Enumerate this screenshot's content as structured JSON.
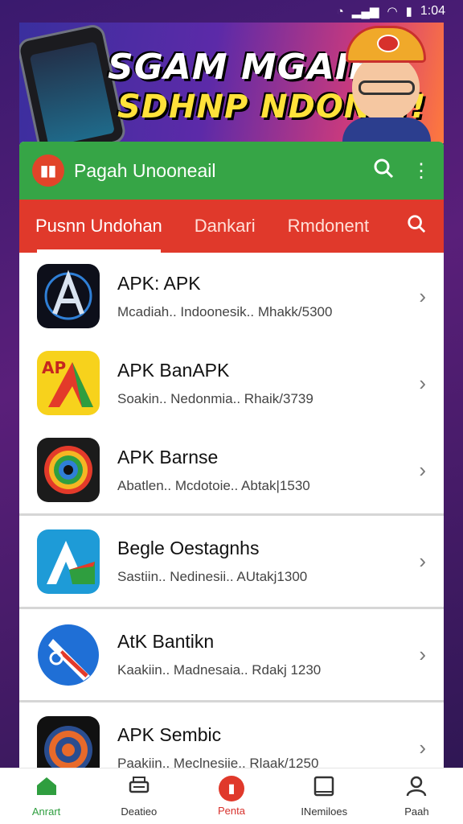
{
  "status_bar": {
    "time": "1:04",
    "icons": [
      "notification-icon",
      "signal-icon",
      "wifi-icon",
      "battery-icon"
    ]
  },
  "banner": {
    "line1": "SGAM MGAIEA",
    "line2": "SDHNP NDONS!!"
  },
  "app_bar": {
    "title": "Pagah Unooneail",
    "logo_glyph": "▮▮"
  },
  "tabs": [
    {
      "label": "Pusnn Undohan"
    },
    {
      "label": "Dankari"
    },
    {
      "label": "Rmdonent"
    }
  ],
  "apps": [
    {
      "title": "APK: APK",
      "subtitle": "Mcadiah.. Indoonesik.. Mhakk/5300",
      "icon": "dark-a-logo-icon"
    },
    {
      "title": "APK BanAPK",
      "subtitle": "Soakin.. Nedonmia.. Rhaik/3739",
      "icon": "yellow-ap-logo-icon"
    },
    {
      "title": "APK Barnse",
      "subtitle": "Abatlen.. Mcdotoie.. Abtak|1530",
      "icon": "rainbow-lens-icon"
    },
    {
      "title": "Begle Oestagnhs",
      "subtitle": "Sastiin.. Nedinesii.. AUtakj1300",
      "icon": "blue-a-flag-icon"
    },
    {
      "title": "AtK Bantikn",
      "subtitle": "Kaakiin.. Madnesaia.. Rdakj 1230",
      "icon": "blue-circle-figure-icon"
    },
    {
      "title": "APK Sembic",
      "subtitle": "Paakiin.. Meclnesiie.. Rlaak/1250",
      "icon": "orange-target-icon"
    }
  ],
  "bottom_nav": [
    {
      "label": "Anrart",
      "icon": "home-icon"
    },
    {
      "label": "Deatieo",
      "icon": "printer-icon"
    },
    {
      "label": "Penta",
      "icon": "red-badge-icon"
    },
    {
      "label": "INemiloes",
      "icon": "window-icon"
    },
    {
      "label": "Paah",
      "icon": "person-icon"
    }
  ]
}
